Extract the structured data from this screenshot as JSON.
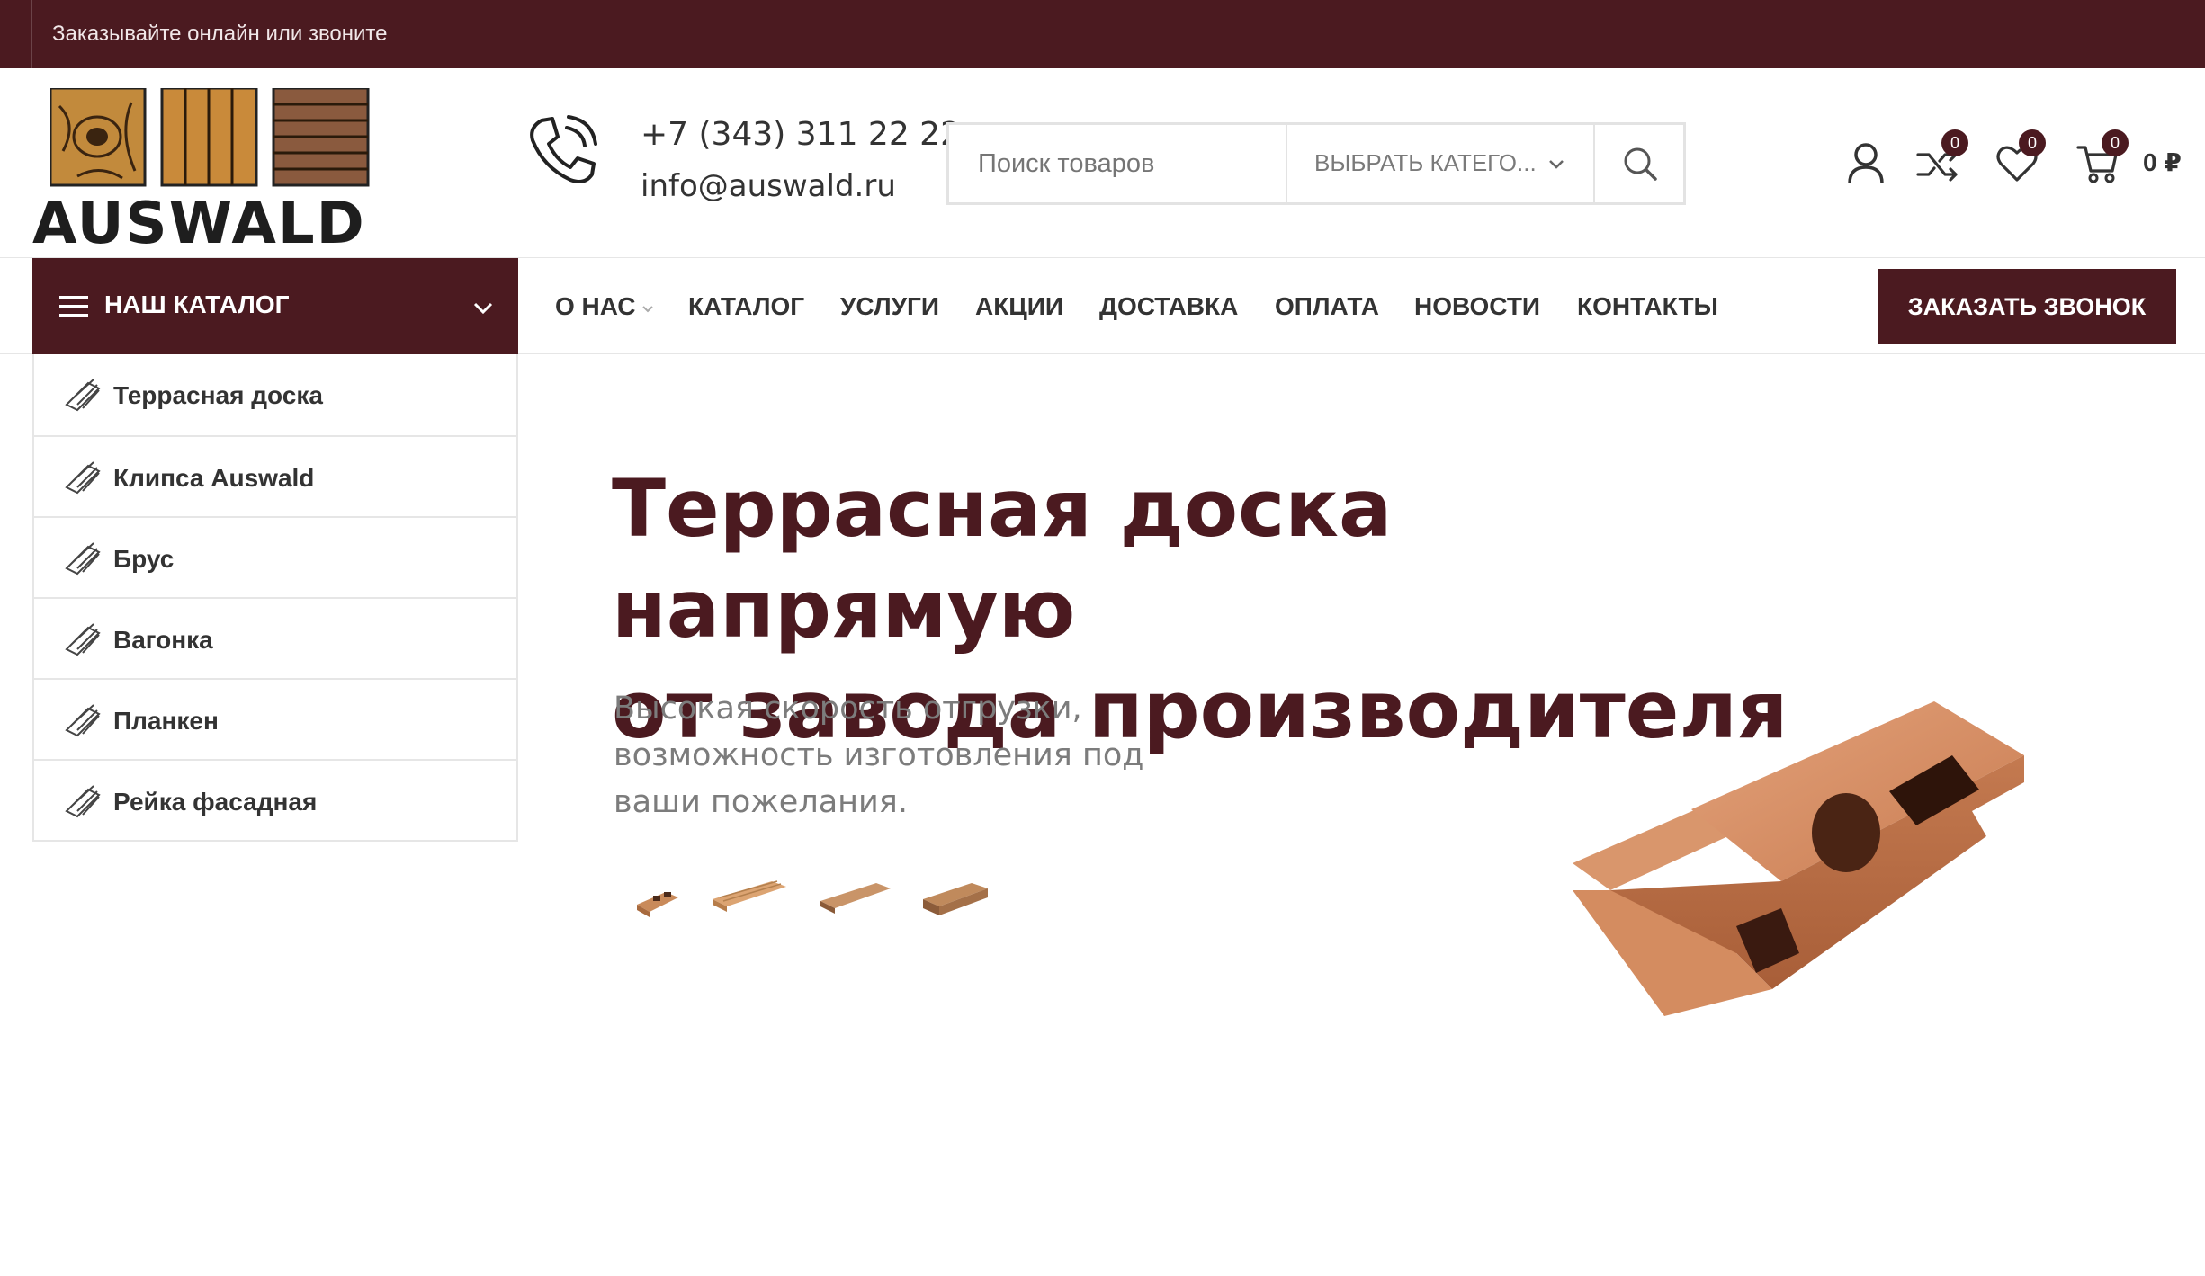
{
  "topbar": {
    "message": "Заказывайте онлайн или звоните"
  },
  "brand": {
    "name": "AUSWALD"
  },
  "contact": {
    "phone": "+7 (343) 311 22 22",
    "email": "info@auswald.ru"
  },
  "search": {
    "placeholder": "Поиск товаров",
    "category_label": "ВЫБРАТЬ КАТЕГО..."
  },
  "header_icons": {
    "compare_count": "0",
    "wishlist_count": "0",
    "cart_count": "0",
    "cart_total": "0 ₽"
  },
  "catalog_button": {
    "label": "НАШ КАТАЛОГ"
  },
  "nav": {
    "items": [
      {
        "label": "О НАС"
      },
      {
        "label": "КАТАЛОГ"
      },
      {
        "label": "УСЛУГИ"
      },
      {
        "label": "АКЦИИ"
      },
      {
        "label": "ДОСТАВКА"
      },
      {
        "label": "ОПЛАТА"
      },
      {
        "label": "НОВОСТИ"
      },
      {
        "label": "КОНТАКТЫ"
      }
    ],
    "call_button": "ЗАКАЗАТЬ ЗВОНОК"
  },
  "categories": [
    {
      "label": "Террасная доска"
    },
    {
      "label": "Клипса Auswald"
    },
    {
      "label": "Брус"
    },
    {
      "label": "Вагонка"
    },
    {
      "label": "Планкен"
    },
    {
      "label": "Рейка фасадная"
    }
  ],
  "hero": {
    "title_line1": "Террасная доска напрямую",
    "title_line2": "от завода производителя",
    "subtitle_line1": "Высокая скорость отгрузки,",
    "subtitle_line2": "возможность изготовления под",
    "subtitle_line3": "ваши пожелания."
  },
  "colors": {
    "brand": "#4b1a20",
    "wood": "#c98a4f"
  }
}
